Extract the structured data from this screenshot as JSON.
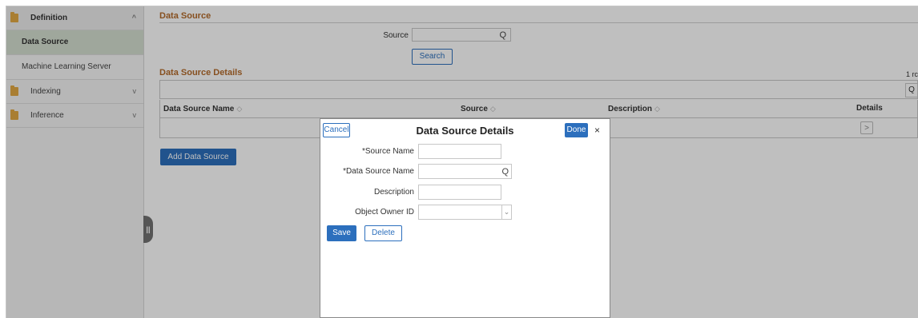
{
  "sidebar": {
    "items": [
      {
        "label": "Definition",
        "type": "group",
        "expanded": true,
        "chevron": "^"
      },
      {
        "label": "Data Source",
        "type": "sub",
        "active": true
      },
      {
        "label": "Machine Learning Server",
        "type": "sub",
        "active": false
      },
      {
        "label": "Indexing",
        "type": "group",
        "expanded": false,
        "chevron": "v"
      },
      {
        "label": "Inference",
        "type": "group",
        "expanded": false,
        "chevron": "v"
      }
    ]
  },
  "data_source": {
    "title": "Data Source",
    "source_label": "Source",
    "source_value": "",
    "search_button": "Search"
  },
  "details": {
    "title": "Data Source Details",
    "rows_indicator": "1 rc",
    "columns": [
      {
        "label": "Data Source Name",
        "sort_icon": "◇"
      },
      {
        "label": "Source",
        "sort_icon": "◇"
      },
      {
        "label": "Description",
        "sort_icon": "◇"
      },
      {
        "label": "Details"
      }
    ],
    "row_details_icon": ">",
    "add_button": "Add Data Source"
  },
  "modal": {
    "title": "Data Source Details",
    "cancel": "Cancel",
    "done": "Done",
    "close": "×",
    "fields": [
      {
        "label": "*Source Name",
        "value": ""
      },
      {
        "label": "*Data Source Name",
        "value": ""
      },
      {
        "label": "Description",
        "value": ""
      },
      {
        "label": "Object Owner ID",
        "value": ""
      }
    ],
    "save": "Save",
    "delete": "Delete"
  },
  "icons": {
    "search": "Q",
    "dropdown": "⌄",
    "pull_handle": "||"
  },
  "colors": {
    "accent": "#2c6fbd",
    "section_title": "#b46b2b",
    "active_nav": "#d5dfd1",
    "folder": "#e2a843"
  }
}
